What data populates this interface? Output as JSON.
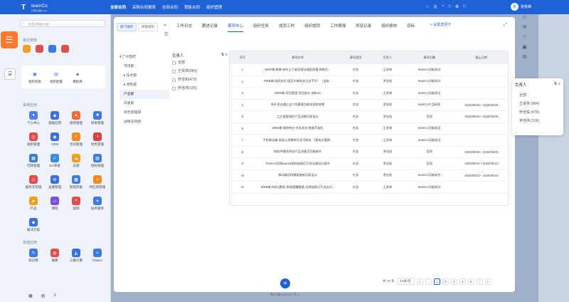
{
  "app": {
    "logo": "T",
    "name": "teamCo",
    "tagline": "行政云盘 ▸ ▸ ▸"
  },
  "top_nav": [
    "全部合同",
    "采购合同报表",
    "全部合同",
    "销售合同",
    "组织管理"
  ],
  "top_icons": [
    "♢",
    "◎",
    "◔",
    "⌂",
    "⚙",
    "□"
  ],
  "user": {
    "avatar": "张",
    "name": "张俊峰"
  },
  "left": {
    "search_placeholder": "全局搜索内容",
    "sections": {
      "recent": "最近使用",
      "system": "系统应用",
      "extra": "增值应用"
    },
    "recent_apps": [
      {
        "label": "组织权限",
        "icon": "▣",
        "color": "#3b7be0"
      },
      {
        "label": "组织配置",
        "icon": "▤",
        "color": "#4b6fd6"
      },
      {
        "label": "模板库",
        "icon": "◈",
        "color": "#555"
      }
    ],
    "system_apps": [
      {
        "label": "个人中心",
        "icon": "●",
        "color": "#4d7ff0"
      },
      {
        "label": "基础应用",
        "icon": "◆",
        "color": "#3a6fe0"
      },
      {
        "label": "绩效管理",
        "icon": "▲",
        "color": "#ee6a3a"
      },
      {
        "label": "研发管理",
        "icon": "■",
        "color": "#3b7be0"
      },
      {
        "label": "组织管理",
        "icon": "◎",
        "color": "#e24c4c"
      },
      {
        "label": "CRM",
        "icon": "◉",
        "color": "#3a6fe0"
      },
      {
        "label": "合同管理",
        "icon": "◐",
        "color": "#f08a24"
      },
      {
        "label": "财务管理",
        "icon": "◑",
        "color": "#d6453d"
      },
      {
        "label": "行政管理",
        "icon": "▦",
        "color": "#3b7be0"
      },
      {
        "label": "OA审批",
        "icon": "✓",
        "color": "#3a8ee0"
      },
      {
        "label": "云盘",
        "icon": "☁",
        "color": "#f0a020"
      },
      {
        "label": "招标管理",
        "icon": "▧",
        "color": "#3b7be0"
      },
      {
        "label": "服务支管理",
        "icon": "◇",
        "color": "#e24c4c"
      },
      {
        "label": "运维管理",
        "icon": "⚙",
        "color": "#3a6fe0"
      },
      {
        "label": "智能装备",
        "icon": "▩",
        "color": "#3b7be0"
      },
      {
        "label": "供应商管理",
        "icon": "◒",
        "color": "#f08a24"
      },
      {
        "label": "产品",
        "icon": "▰",
        "color": "#f0a020"
      },
      {
        "label": "课程",
        "icon": "▱",
        "color": "#7b4fd6"
      },
      {
        "label": "案例",
        "icon": "◓",
        "color": "#e24c4c"
      },
      {
        "label": "技术服务",
        "icon": "✦",
        "color": "#3b7be0"
      },
      {
        "label": "解决方案",
        "icon": "◆",
        "color": "#3a6fe0"
      }
    ],
    "extra_apps": [
      {
        "label": "知识库",
        "icon": "✎",
        "color": "#3b7be0"
      },
      {
        "label": "微库",
        "icon": "◍",
        "color": "#e24c4c"
      },
      {
        "label": "三维引擎",
        "icon": "◭",
        "color": "#3a6fe0"
      },
      {
        "label": "ChatAI",
        "icon": "✧",
        "color": "#3b7be0"
      }
    ],
    "bottom": [
      "▦",
      "▤",
      "≡"
    ]
  },
  "float_icons": [
    "☰",
    "⌸"
  ],
  "main": {
    "org_tabs": [
      "部门组织",
      "跨部组织"
    ],
    "tabs": [
      "工作日志",
      "跟进记录",
      "事项中心",
      "组织任务",
      "成员工时",
      "组织成员",
      "工作周报",
      "奖惩记录",
      "组织绩效",
      "目标"
    ],
    "active_tab": "事项中心",
    "add_tab": "+ 设置选项卡",
    "tree": [
      "广州首府",
      "市场部",
      "技术部",
      "销售部",
      "产品部",
      "开发部",
      "综合管理部",
      "战略支持部"
    ],
    "filter": {
      "title": "负责人",
      "options": [
        "全部",
        "王贤林(984)",
        "罗佳佑(479)",
        "罗佳炜(105)"
      ]
    },
    "columns": [
      "序号",
      "事项名称",
      "事项类型",
      "负责人",
      "事项归属",
      "截止日期"
    ],
    "rows": [
      [
        "1",
        "WEB端-群聊 有时上下来回滚动速度很慢 刷新后...",
        "任务",
        "王贤林",
        "teamCo功能测试",
        ""
      ],
      [
        "2",
        "WEB端-组织成员 组员头像失录点击不开？（当前...",
        "任务",
        "罗佳佑",
        "teamCo功能测试",
        ""
      ],
      [
        "3",
        "WEB端-项目管理 项目统计 选BUG",
        "任务",
        "王贤林",
        "teamCo功能测试",
        ""
      ],
      [
        "4",
        "和开发沟通企业介绍模版功能实现的效果",
        "任务",
        "罗佳佑",
        "teamCo产品研发",
        "2025/09/28 ~ 2025/09/28"
      ],
      [
        "5",
        "工三维管理的产品详情页面设计",
        "任务",
        "罗佳佑",
        "官网",
        "2025/09/26 ~ 2025/09/26"
      ],
      [
        "6",
        "WEB端-我的待办 任务状态 数据不准乱",
        "任务",
        "王贤林",
        "teamCo功能测试",
        ""
      ],
      [
        "7",
        "手机移动端-无部认领跳转后也可能有 《我有次要掉...",
        "任务",
        "王贤林",
        "teamCo功能测试",
        ""
      ],
      [
        "8",
        "和软件模块测试产品详情页功能制作",
        "任务",
        "罗佳佑",
        "官网",
        "2025/09/25 ~ 2025/09/25"
      ],
      [
        "9",
        "Teamco官网banner图样修改后开发沟通设计细节",
        "任务",
        "罗佳佑",
        "官网",
        "2025/09/24 ~ 2025/09/24"
      ],
      [
        "10",
        "移动端官网模板查新页面设计",
        "任务",
        "罗佳佑",
        "teamCo功能研究",
        "2025/09/23 ~ 2025/09/23"
      ],
      [
        "11",
        "WEB端-待办(通知)-系统提醒数量 选择链接点不进去点...",
        "任务",
        "王贤林",
        "teamCo功能测试",
        ""
      ]
    ],
    "pager": {
      "total": "共 75 条",
      "size": "15条/页",
      "pages": [
        "1",
        "2",
        "3",
        "4",
        "5"
      ],
      "prev": "‹",
      "next": "›",
      "first": "«",
      "last": "»"
    },
    "footer": "粤ICP备14015727号-4"
  },
  "right_icons": [
    "⚇",
    "✉",
    "☺",
    "▣",
    "⚙"
  ],
  "dropdown": {
    "title": "负责人",
    "options": [
      "全部",
      "王贤林 (984)",
      "罗佳佑 (479)",
      "罗佳炜 (105)"
    ]
  }
}
